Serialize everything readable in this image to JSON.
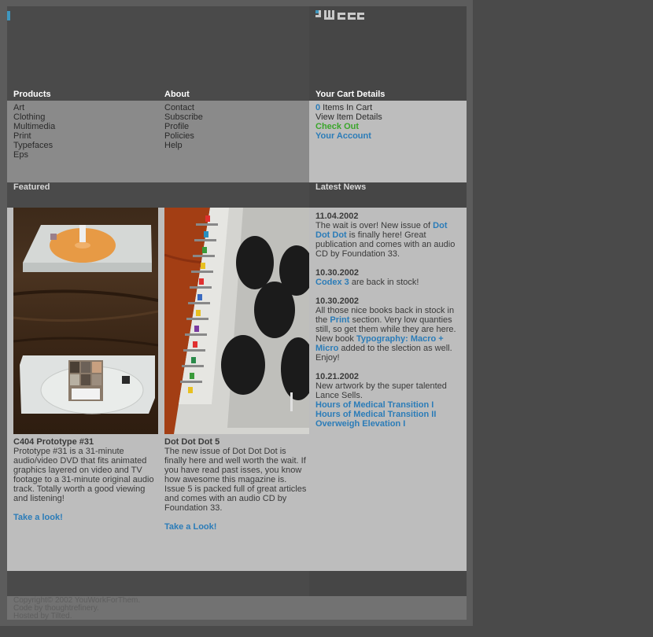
{
  "header": {
    "logo_text": "YWFT"
  },
  "nav": {
    "products": {
      "title": "Products",
      "items": [
        "Art",
        "Clothing",
        "Multimedia",
        "Print",
        "Typefaces",
        "Eps"
      ]
    },
    "about": {
      "title": "About",
      "items": [
        "Contact",
        "Subscribe",
        "Profile",
        "Policies",
        "Help"
      ]
    },
    "cart": {
      "title": "Your Cart Details",
      "count": "0",
      "count_label": " Items In Cart",
      "view_details": "View Item Details",
      "checkout": "Check Out",
      "account": "Your Account"
    }
  },
  "featured": {
    "title": "Featured",
    "items": [
      {
        "title": "C404 Prototype #31",
        "description": "Prototype #31 is a 31-minute audio/video DVD that fits animated graphics layered on video and TV footage to a 31-minute original audio track. Totally worth a good viewing and listening!",
        "link": "Take a look!",
        "image_alt": "DVD cases on wooden table"
      },
      {
        "title": "Dot Dot Dot 5",
        "description": "The new issue of Dot Dot Dot is finally here and well worth the wait. If you have read past isses, you know how awesome this magazine is. Issue 5 is packed full of great articles and comes with an audio CD by Foundation 33.",
        "link": "Take a Look!",
        "image_alt": "Magazine cover with rocket engines"
      }
    ]
  },
  "news": {
    "title": "Latest News",
    "entries": [
      {
        "date": "11.04.2002",
        "t1": "The wait is over! New issue of ",
        "l1": "Dot Dot Dot",
        "t2": " is finally here! Great publication and comes with an audio CD by Foundation 33."
      },
      {
        "date": "10.30.2002",
        "l1": "Codex 3",
        "t1": " are back in stock!"
      },
      {
        "date": "10.30.2002",
        "t1": "All those nice books back in stock in the ",
        "l1": "Print",
        "t2": " section. Very low quanties still, so get them while they are here. New book ",
        "l2": "Typography: Macro + Micro",
        "t3": " added to the slection as well. Enjoy!"
      },
      {
        "date": "10.21.2002",
        "t1": "New artwork by the super talented Lance Sells.",
        "links": [
          "Hours of Medical Transition I",
          "Hours of Medical Transition II",
          "Overweigh Elevation I"
        ]
      }
    ]
  },
  "footer": {
    "lines": [
      "Copyright© 2002 YouWorkForThem.",
      "Code by thoughtrefinery.",
      "Hosted by Tilted."
    ]
  },
  "colors": {
    "link_blue": "#2b7cb8",
    "checkout_green": "#3aa52b",
    "logo_accent": "#3e97bf"
  }
}
